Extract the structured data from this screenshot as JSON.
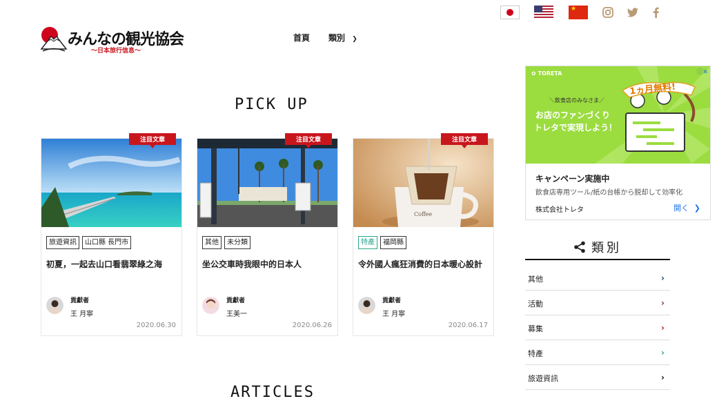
{
  "header": {
    "logo_title": "みんなの観光協会",
    "logo_subtitle": "〜日本旅行信息〜",
    "languages": [
      "japan-flag",
      "usa-flag",
      "china-flag"
    ],
    "social": [
      "instagram-icon",
      "twitter-icon",
      "facebook-icon"
    ],
    "nav": {
      "home": "首頁",
      "category": "類別"
    }
  },
  "pickup": {
    "title": "PICK UP",
    "cards": [
      {
        "ribbon": "注目文章",
        "tags": [
          "旅遊資訊",
          "山口縣 長門市"
        ],
        "title": "初夏，一起去山口看翡翠綠之海",
        "contributor_label": "貢獻者",
        "contributor": "王 月寧",
        "date": "2020.06.30"
      },
      {
        "ribbon": "注目文章",
        "tags": [
          "其他",
          "未分類"
        ],
        "title": "坐公交車時我眼中的日本人",
        "contributor_label": "貢獻者",
        "contributor": "王美一",
        "date": "2020.06.26"
      },
      {
        "ribbon": "注目文章",
        "tags": [
          "特產",
          "福岡縣"
        ],
        "title": "令外國人瘋狂消費的日本暖心設計",
        "contributor_label": "貢獻者",
        "contributor": "王 月寧",
        "date": "2020.06.17"
      }
    ]
  },
  "articles": {
    "title": "ARTICLES"
  },
  "ad": {
    "brand": "TORETA",
    "banner_small": "＼飲食店のみなさま／",
    "banner_line1": "お店のファンづくり",
    "banner_line2": "トレタで実現しよう！",
    "badge": "1ヵ月無料!",
    "headline": "キャンペーン実施中",
    "description": "飲食店専用ツール/紙の台帳から脱却して効率化",
    "company": "株式会社トレタ",
    "open_label": "開く"
  },
  "categories": {
    "title": "類別",
    "items": [
      {
        "label": "其他",
        "color": "#1f3b7a"
      },
      {
        "label": "活動",
        "color": "#8a1f5a"
      },
      {
        "label": "募集",
        "color": "#c8161d"
      },
      {
        "label": "特產",
        "color": "#2aa58a"
      },
      {
        "label": "旅遊資訊",
        "color": "#111111"
      }
    ]
  }
}
